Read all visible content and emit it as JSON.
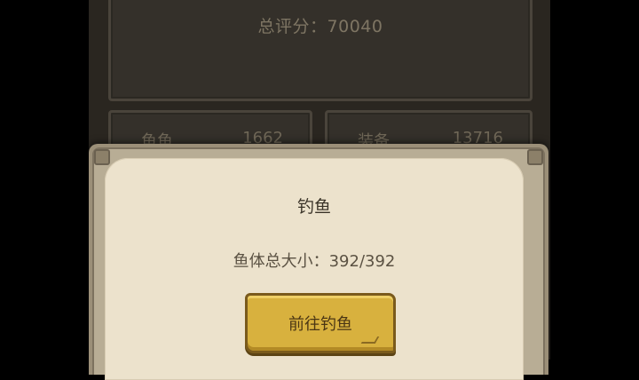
{
  "background": {
    "score_text": "总评分：70040",
    "stats": [
      {
        "label": "鱼鱼",
        "value": "1662"
      },
      {
        "label": "装备",
        "value": "13716"
      }
    ]
  },
  "dialog": {
    "title": "钓鱼",
    "info_line": "鱼体总大小：392/392",
    "button_label": "前往钓鱼"
  },
  "colors": {
    "backdrop": "#2a2620",
    "dialog_paper": "#ece2cc",
    "button_gold": "#d8b13e"
  }
}
